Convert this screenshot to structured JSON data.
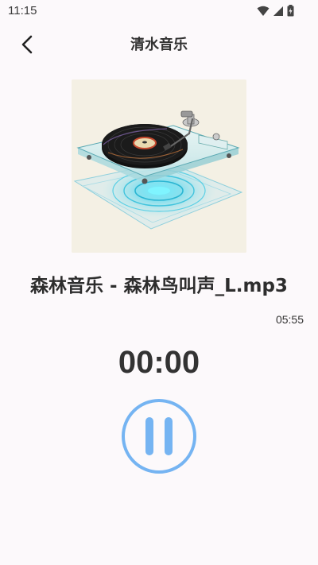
{
  "status_bar": {
    "time": "11:15",
    "icons": [
      "wifi-icon",
      "signal-icon",
      "battery-icon"
    ]
  },
  "header": {
    "title": "清水音乐",
    "back_icon": "back-arrow-icon"
  },
  "player": {
    "album_art_icon": "turntable-record-illustration",
    "track_name": "森林音乐 - 森林鸟叫声_L.mp3",
    "duration": "05:55",
    "current_time": "00:00",
    "control_icon": "pause-icon",
    "accent_color": "#75b4f2"
  }
}
